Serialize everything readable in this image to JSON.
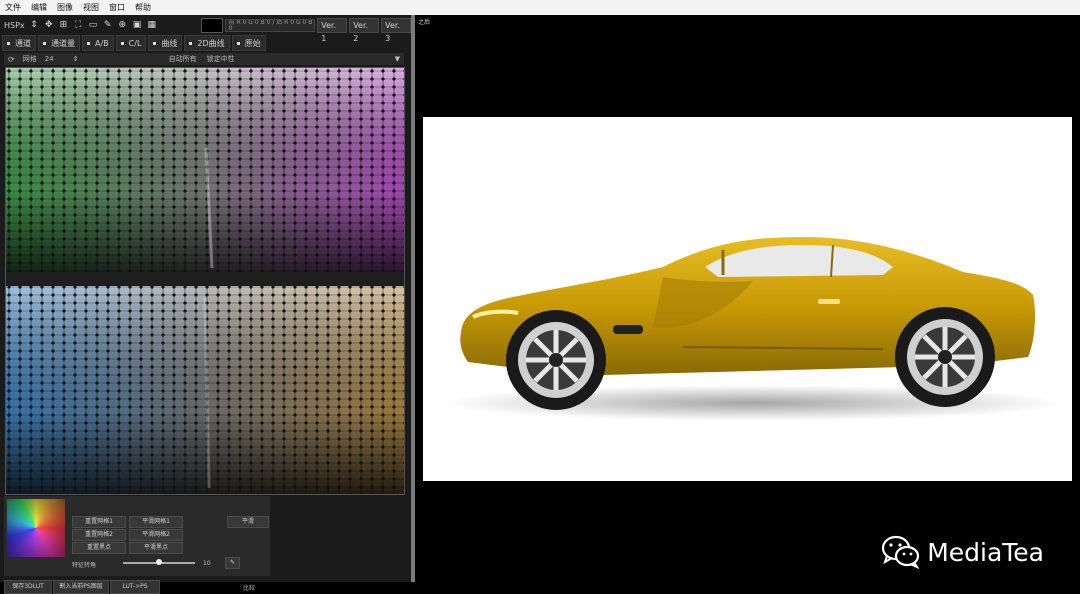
{
  "menu": [
    "文件",
    "编辑",
    "图像",
    "视图",
    "窗口",
    "帮助"
  ],
  "toolbar": {
    "color_mode": "HSPx",
    "rgb_readout": "前 R 0 G 0 B 0 / 后 R 0 G 0 B 0",
    "versions": [
      "Ver. 1",
      "Ver. 2",
      "Ver. 3"
    ]
  },
  "tabs": [
    "通道",
    "通道量",
    "A/B",
    "C/L",
    "曲线",
    "2D曲线",
    "原始"
  ],
  "grid_controls": {
    "label": "网格",
    "value": "24",
    "auto_label": "自动所有",
    "lock_label": "锁定中性"
  },
  "panel": {
    "buttons_left": [
      "重置网格1",
      "重置网格2",
      "重置黑点"
    ],
    "buttons_right": [
      "平滑网格1",
      "平滑网格2",
      "平滑黑点"
    ],
    "flat_button": "平滑",
    "slider_label": "特征转角",
    "slider_value": "10",
    "slider_level": 0.5
  },
  "footer": {
    "save_lut": "保存3DLUT",
    "import_ps": "割入当前PS图层",
    "lut_ps": "LUT->PS",
    "compare": "比较"
  },
  "preview": {
    "label": "之后"
  },
  "watermark": {
    "brand": "MediaTea"
  },
  "colors": {
    "car_body": "#d4a407",
    "photo_bg": "#ffffff"
  }
}
